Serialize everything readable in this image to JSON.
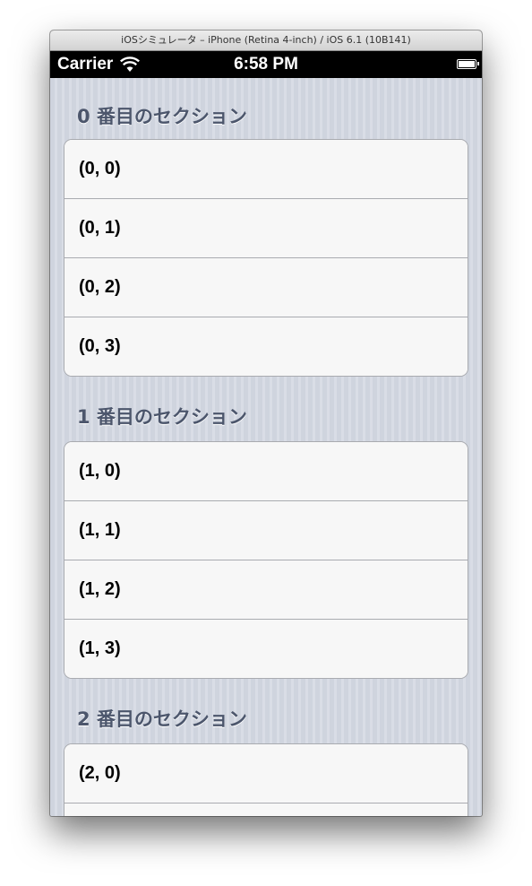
{
  "window": {
    "title": "iOSシミュレータ – iPhone (Retina 4-inch) / iOS 6.1 (10B141)"
  },
  "status_bar": {
    "carrier": "Carrier",
    "time": "6:58 PM",
    "wifi_icon": "wifi-icon",
    "battery_icon": "battery-icon"
  },
  "sections": [
    {
      "header": "0 番目のセクション",
      "rows": [
        "(0, 0)",
        "(0, 1)",
        "(0, 2)",
        "(0, 3)"
      ]
    },
    {
      "header": "1 番目のセクション",
      "rows": [
        "(1, 0)",
        "(1, 1)",
        "(1, 2)",
        "(1, 3)"
      ]
    },
    {
      "header": "2 番目のセクション",
      "rows": [
        "(2, 0)",
        ""
      ]
    }
  ],
  "colors": {
    "section_header_text": "#4c566c",
    "background_stripe_dark": "#cfd4de",
    "background_stripe_light": "#d9dde6",
    "cell_background": "#f7f7f7",
    "separator": "#a9abb0"
  }
}
